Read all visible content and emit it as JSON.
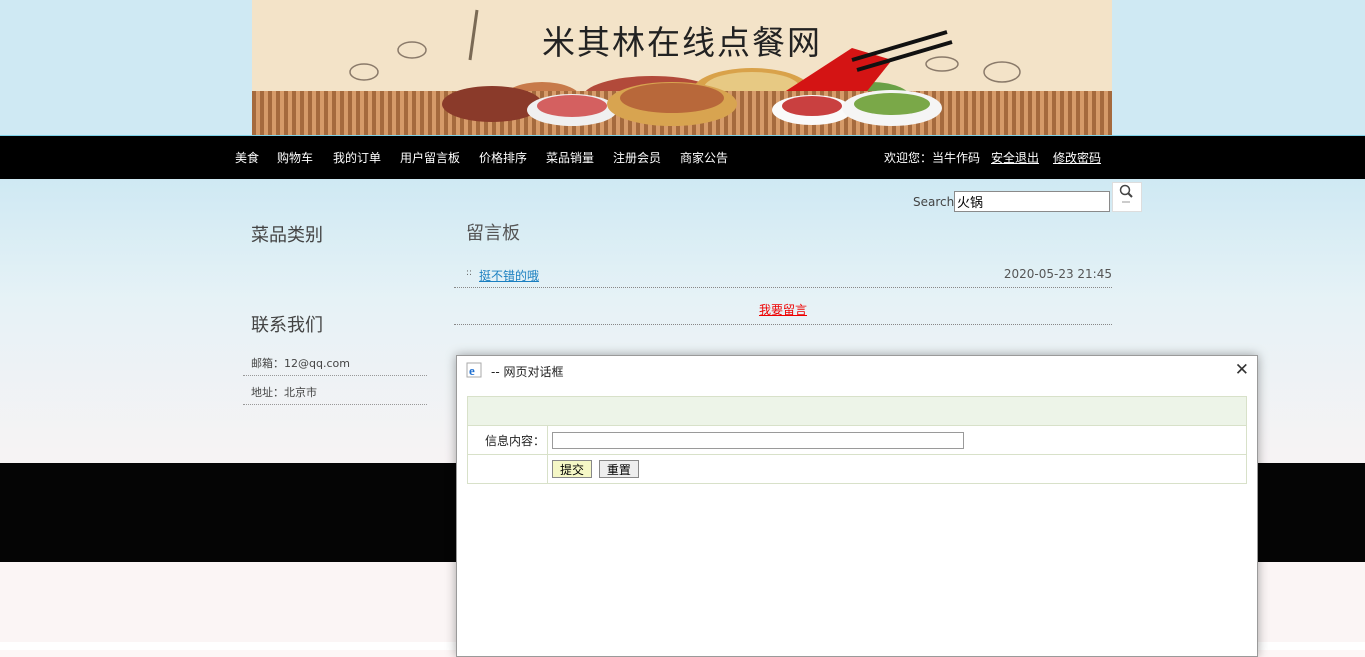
{
  "banner": {
    "title": "米其林在线点餐网"
  },
  "nav": {
    "items": [
      "美食",
      "购物车",
      "我的订单",
      "用户留言板",
      "价格排序",
      "菜品销量",
      "注册会员",
      "商家公告"
    ],
    "welcome": "欢迎您：当牛作码",
    "logout": "安全退出",
    "change_password": "修改密码"
  },
  "search": {
    "label": "Search",
    "value": "火锅",
    "icon": "search-icon"
  },
  "sidebar": {
    "categories_title": "菜品类别",
    "contact_title": "联系我们",
    "email": "邮箱：12@qq.com",
    "address": "地址：北京市"
  },
  "board": {
    "title": "留言板",
    "messages": [
      {
        "title": "挺不错的哦",
        "date": "2020-05-23 21:45"
      }
    ],
    "post_link": "我要留言"
  },
  "dialog": {
    "title": "-- 网页对话框",
    "icon": "ie-icon",
    "close_icon": "close-icon",
    "content_label": "信息内容：",
    "content_value": "",
    "submit": "提交",
    "reset": "重置"
  },
  "colors": {
    "nav_bg": "#000000",
    "top_bg": "#cfe9f3",
    "link": "#1a7fc0",
    "post_link": "#ee0000"
  }
}
